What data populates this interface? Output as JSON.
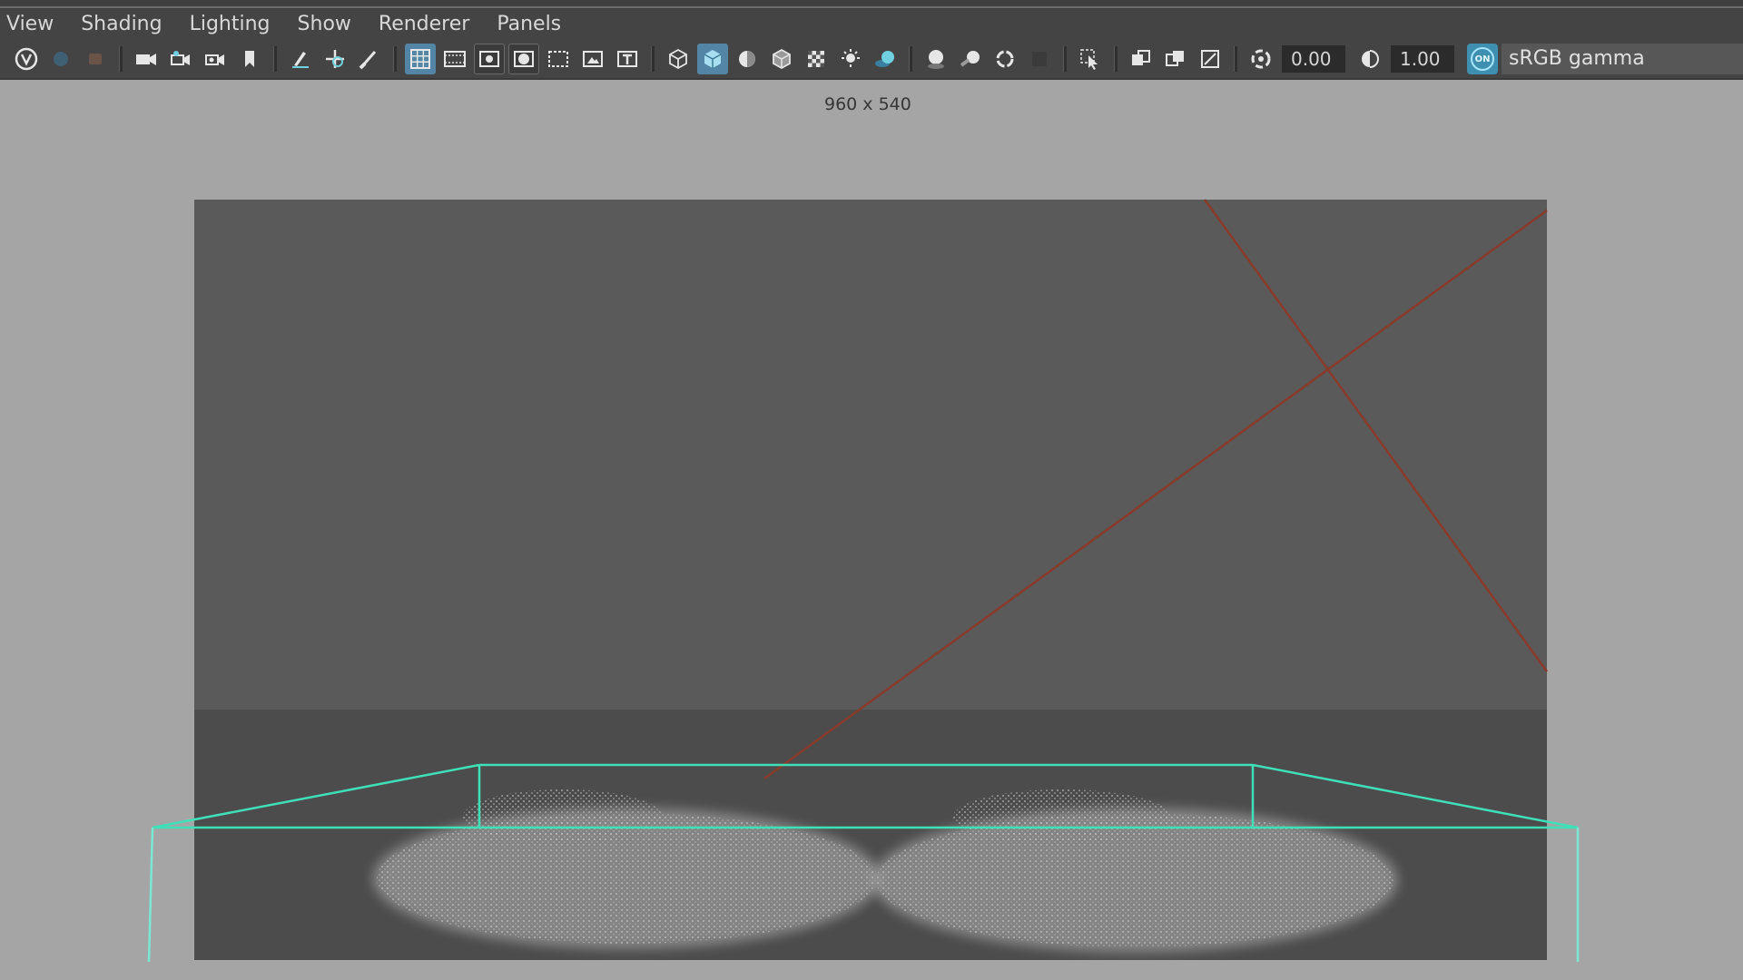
{
  "menu": [
    "View",
    "Shading",
    "Lighting",
    "Show",
    "Renderer",
    "Panels"
  ],
  "toolbar": {
    "exposure_value": "0.00",
    "gamma_value": "1.00",
    "color_management_badge": "ON",
    "color_space": "sRGB gamma"
  },
  "viewport": {
    "resolution_label": "960 x 540"
  }
}
